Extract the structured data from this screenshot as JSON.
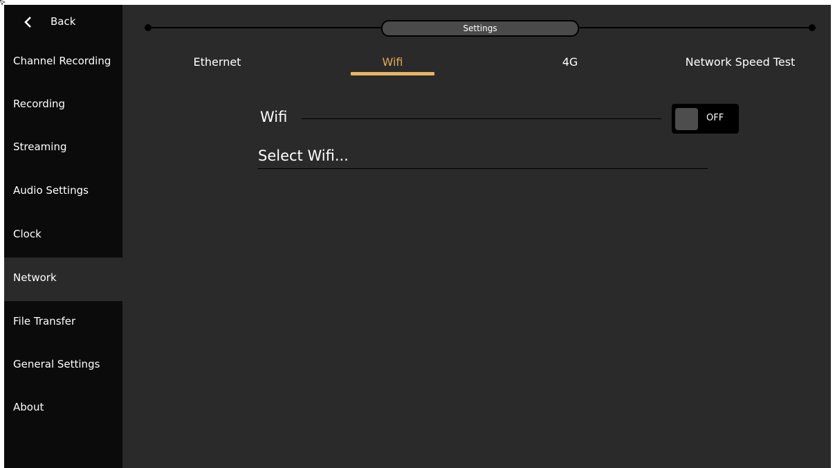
{
  "sidebar": {
    "back_label": "Back",
    "items": [
      {
        "label": "Channel Recording"
      },
      {
        "label": "Recording"
      },
      {
        "label": "Streaming"
      },
      {
        "label": "Audio Settings"
      },
      {
        "label": "Clock"
      },
      {
        "label": "Network",
        "active": true
      },
      {
        "label": "File Transfer"
      },
      {
        "label": "General Settings"
      },
      {
        "label": "About"
      }
    ]
  },
  "header": {
    "title": "Settings"
  },
  "tabs": [
    {
      "label": "Ethernet"
    },
    {
      "label": "Wifi",
      "active": true
    },
    {
      "label": "4G"
    },
    {
      "label": "Network Speed Test"
    }
  ],
  "wifi": {
    "label": "Wifi",
    "toggle_state": "OFF",
    "select_label": "Select Wifi..."
  },
  "colors": {
    "accent": "#e8b465",
    "background": "#2a2a2a",
    "sidebar": "#0b0b0b"
  }
}
